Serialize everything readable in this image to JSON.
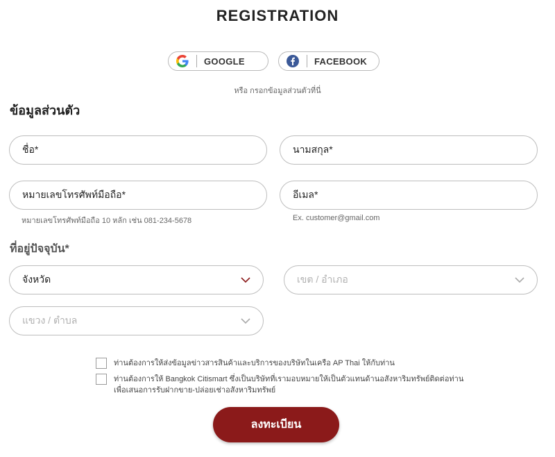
{
  "header": {
    "title": "REGISTRATION"
  },
  "social": {
    "google_label": "GOOGLE",
    "facebook_label": "FACEBOOK",
    "or_text": "หรือ กรอกข้อมูลส่วนตัวที่นี่"
  },
  "personal": {
    "heading": "ข้อมูลส่วนตัว",
    "first_name": "ชื่อ*",
    "last_name": "นามสกุล*",
    "phone": "หมายเลขโทรศัพท์มือถือ*",
    "phone_hint": "หมายเลขโทรศัพท์มือถือ 10 หลัก เช่น 081-234-5678",
    "email": "อีเมล*",
    "email_hint": "Ex. customer@gmail.com"
  },
  "address": {
    "heading": "ที่อยู่ปัจจุบัน*",
    "province": "จังหวัด",
    "district": "เขต / อำเภอ",
    "subdistrict": "แขวง / ตำบล"
  },
  "consents": {
    "item1": "ท่านต้องการให้ส่งข้อมูลข่าวสารสินค้าและบริการของบริษัทในเครือ AP Thai ให้กับท่าน",
    "item2_line1": "ท่านต้องการให้ Bangkok Citismart ซึ่งเป็นบริษัทที่เรามอบหมายให้เป็นตัวแทนด้านอสังหาริมทรัพย์ติดต่อท่าน",
    "item2_line2": "เพื่อเสนอการรับฝากขาย-ปล่อยเช่าอสังหาริมทรัพย์"
  },
  "submit": {
    "label": "ลงทะเบียน"
  },
  "colors": {
    "accent": "#8b1a1a",
    "chevron_active": "#8b1a1a",
    "chevron_inactive": "#aaaaaa"
  }
}
